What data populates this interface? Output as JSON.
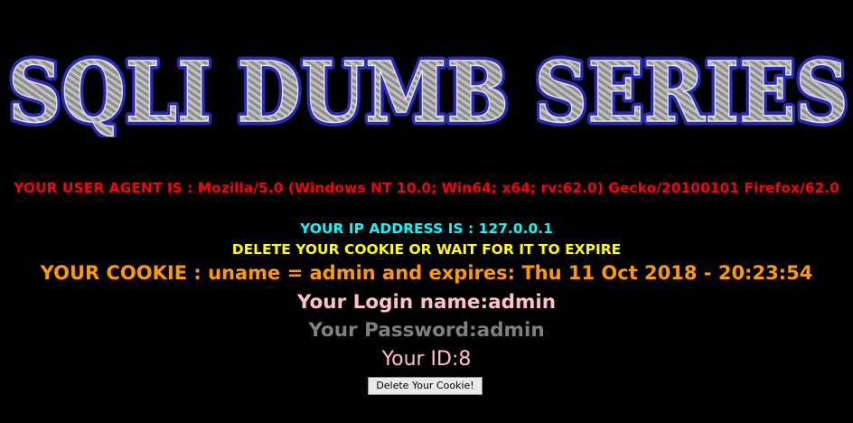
{
  "banner": {
    "title": "SQLI DUMB SERIES"
  },
  "info": {
    "user_agent_line": "YOUR USER AGENT IS : Mozilla/5.0 (Windows NT 10.0; Win64; x64; rv:62.0) Gecko/20100101 Firefox/62.0",
    "ip_line": "YOUR IP ADDRESS IS : 127.0.0.1",
    "delete_notice": "DELETE YOUR COOKIE OR WAIT FOR IT TO EXPIRE",
    "cookie_line": "YOUR COOKIE : uname = admin and expires: Thu 11 Oct 2018 - 20:23:54",
    "login_line": "Your Login name:admin",
    "password_line": "Your Password:admin",
    "id_line": "Your ID:8"
  },
  "actions": {
    "delete_cookie_label": "Delete Your Cookie!"
  },
  "colors": {
    "background": "#000000",
    "user_agent": "#ff0000",
    "ip": "#00ffff",
    "notice": "#ffff00",
    "cookie": "#ff9900",
    "login": "#ffc0cb",
    "password": "#808080",
    "banner_outline": "#1a1a8c",
    "banner_fill": "#b3b3b3"
  }
}
